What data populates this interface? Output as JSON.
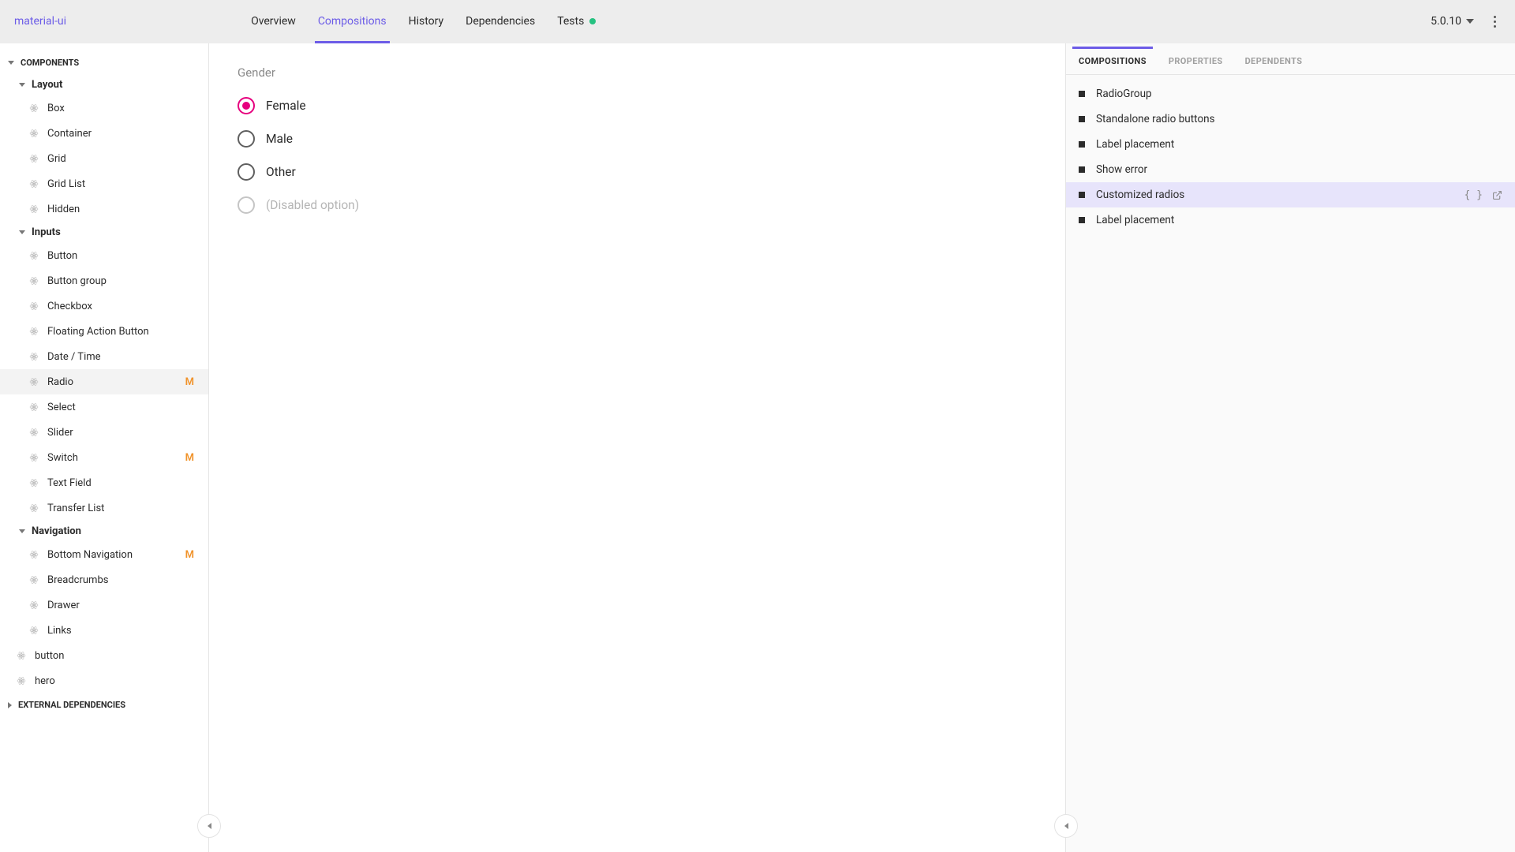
{
  "brand": "material-ui",
  "tabs": {
    "overview": "Overview",
    "compositions": "Compositions",
    "history": "History",
    "dependencies": "Dependencies",
    "tests": "Tests"
  },
  "active_tab": "compositions",
  "version": "5.0.10",
  "sidebar": {
    "sections": {
      "components": "Components",
      "external_deps": "External Dependencies"
    },
    "groups": {
      "layout": "Layout",
      "inputs": "Inputs",
      "navigation": "Navigation"
    },
    "layout_items": [
      "Box",
      "Container",
      "Grid",
      "Grid List",
      "Hidden"
    ],
    "inputs_items": [
      "Button",
      "Button group",
      "Checkbox",
      "Floating Action Button",
      "Date / Time",
      "Radio",
      "Select",
      "Slider",
      "Switch",
      "Text Field",
      "Transfer List"
    ],
    "nav_items": [
      "Bottom Navigation",
      "Breadcrumbs",
      "Drawer",
      "Links"
    ],
    "top_items": [
      "button",
      "hero"
    ],
    "modified_badge": "M",
    "selected": "Radio"
  },
  "preview": {
    "legend": "Gender",
    "options": [
      {
        "label": "Female",
        "checked": true,
        "disabled": false
      },
      {
        "label": "Male",
        "checked": false,
        "disabled": false
      },
      {
        "label": "Other",
        "checked": false,
        "disabled": false
      },
      {
        "label": "(Disabled option)",
        "checked": false,
        "disabled": true
      }
    ]
  },
  "right_panel": {
    "tabs": {
      "compositions": "Compositions",
      "properties": "Properties",
      "dependents": "Dependents"
    },
    "active_tab": "compositions",
    "items": [
      "RadioGroup",
      "Standalone radio buttons",
      "Label placement",
      "Show error",
      "Customized radios",
      "Label placement"
    ],
    "selected_index": 4
  }
}
